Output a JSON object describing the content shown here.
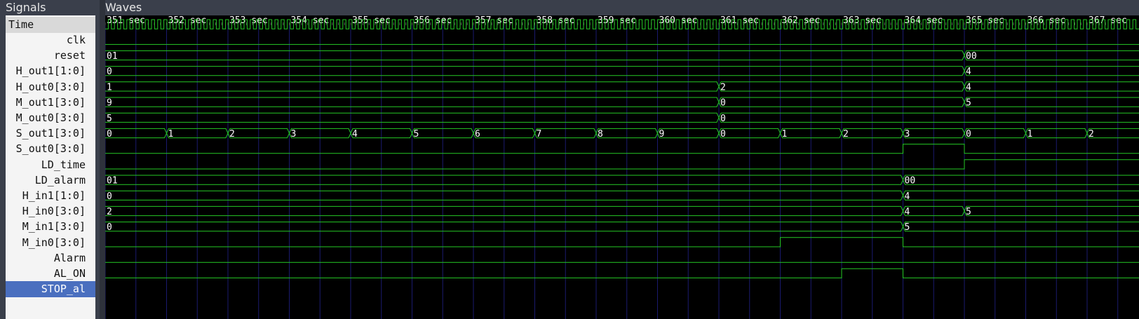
{
  "panels": {
    "signals_title": "Signals",
    "waves_title": "Waves"
  },
  "time_axis": {
    "header": "Time",
    "ticks": [
      "351 sec",
      "352 sec",
      "353 sec",
      "354 sec",
      "355 sec",
      "356 sec",
      "357 sec",
      "358 sec",
      "359 sec",
      "360 sec",
      "361 sec",
      "362 sec",
      "363 sec",
      "364 sec",
      "365 sec",
      "366 sec",
      "367 sec"
    ],
    "start": 351,
    "end": 367.5
  },
  "colors": {
    "wave": "#25c825",
    "grid": "#1a1a6e",
    "selected": "#4a6fbf"
  },
  "signals": [
    {
      "name": "clk",
      "kind": "clock"
    },
    {
      "name": "reset",
      "kind": "bit",
      "changes": [
        [
          351,
          0
        ]
      ]
    },
    {
      "name": "H_out1[1:0]",
      "kind": "bus",
      "changes": [
        [
          351,
          "01"
        ],
        [
          365,
          "00"
        ]
      ]
    },
    {
      "name": "H_out0[3:0]",
      "kind": "bus",
      "changes": [
        [
          351,
          "0"
        ],
        [
          365,
          "4"
        ]
      ]
    },
    {
      "name": "M_out1[3:0]",
      "kind": "bus",
      "changes": [
        [
          351,
          "1"
        ],
        [
          361,
          "2"
        ],
        [
          365,
          "4"
        ]
      ]
    },
    {
      "name": "M_out0[3:0]",
      "kind": "bus",
      "changes": [
        [
          351,
          "9"
        ],
        [
          361,
          "0"
        ],
        [
          365,
          "5"
        ]
      ]
    },
    {
      "name": "S_out1[3:0]",
      "kind": "bus",
      "changes": [
        [
          351,
          "5"
        ],
        [
          361,
          "0"
        ]
      ]
    },
    {
      "name": "S_out0[3:0]",
      "kind": "bus",
      "changes": [
        [
          351,
          "0"
        ],
        [
          352,
          "1"
        ],
        [
          353,
          "2"
        ],
        [
          354,
          "3"
        ],
        [
          355,
          "4"
        ],
        [
          356,
          "5"
        ],
        [
          357,
          "6"
        ],
        [
          358,
          "7"
        ],
        [
          359,
          "8"
        ],
        [
          360,
          "9"
        ],
        [
          361,
          "0"
        ],
        [
          362,
          "1"
        ],
        [
          363,
          "2"
        ],
        [
          364,
          "3"
        ],
        [
          365,
          "0"
        ],
        [
          366,
          "1"
        ],
        [
          367,
          "2"
        ]
      ]
    },
    {
      "name": "LD_time",
      "kind": "bit",
      "changes": [
        [
          351,
          0
        ],
        [
          364,
          1
        ],
        [
          365,
          0
        ]
      ]
    },
    {
      "name": "LD_alarm",
      "kind": "bit",
      "changes": [
        [
          351,
          0
        ],
        [
          365,
          1
        ]
      ]
    },
    {
      "name": "H_in1[1:0]",
      "kind": "bus",
      "changes": [
        [
          351,
          "01"
        ],
        [
          364,
          "00"
        ]
      ]
    },
    {
      "name": "H_in0[3:0]",
      "kind": "bus",
      "changes": [
        [
          351,
          "0"
        ],
        [
          364,
          "4"
        ]
      ]
    },
    {
      "name": "M_in1[3:0]",
      "kind": "bus",
      "changes": [
        [
          351,
          "2"
        ],
        [
          364,
          "4"
        ],
        [
          365,
          "5"
        ]
      ]
    },
    {
      "name": "M_in0[3:0]",
      "kind": "bus",
      "changes": [
        [
          351,
          "0"
        ],
        [
          364,
          "5"
        ]
      ]
    },
    {
      "name": "Alarm",
      "kind": "bit",
      "changes": [
        [
          351,
          0
        ],
        [
          362,
          1
        ],
        [
          364,
          0
        ]
      ]
    },
    {
      "name": "AL_ON",
      "kind": "bit",
      "changes": [
        [
          351,
          0
        ]
      ]
    },
    {
      "name": "STOP_al",
      "kind": "bit",
      "selected": true,
      "changes": [
        [
          351,
          0
        ],
        [
          363,
          1
        ],
        [
          364,
          0
        ]
      ]
    }
  ]
}
